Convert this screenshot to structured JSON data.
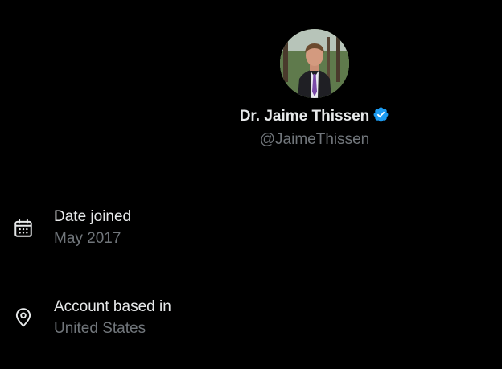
{
  "profile": {
    "display_name": "Dr. Jaime Thissen",
    "handle": "@JaimeThissen",
    "verified": true,
    "verified_color": "#1d9bf0"
  },
  "about": {
    "items": [
      {
        "icon": "calendar-icon",
        "label": "Date joined",
        "value": "May 2017"
      },
      {
        "icon": "location-pin-icon",
        "label": "Account based in",
        "value": "United States"
      }
    ]
  },
  "colors": {
    "background": "#000000",
    "primary_text": "#e7e9ea",
    "secondary_text": "#71767b"
  }
}
